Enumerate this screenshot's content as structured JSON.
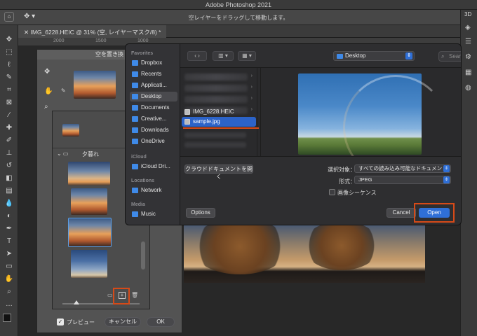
{
  "app": {
    "title": "Adobe Photoshop 2021",
    "hint": "空レイヤーをドラッグして移動します。",
    "doc_tab": "IMG_6228.HEIC @ 31% (空, レイヤーマスク/8) *",
    "ruler_ticks": [
      "2000",
      "1500",
      "1000"
    ],
    "right_panel_label": "3D"
  },
  "sky_dialog": {
    "title": "空を置き換",
    "folder_label": "夕暮れ",
    "preview_label": "プレビュー",
    "cancel_label": "キャンセル",
    "ok_label": "OK"
  },
  "file_dialog": {
    "sidebar": {
      "favorites_header": "Favorites",
      "favorites": [
        {
          "label": "Dropbox",
          "icon": "dropbox-icon"
        },
        {
          "label": "Recents",
          "icon": "clock-icon"
        },
        {
          "label": "Applicati...",
          "icon": "applications-icon"
        },
        {
          "label": "Desktop",
          "icon": "desktop-icon",
          "selected": true
        },
        {
          "label": "Documents",
          "icon": "document-icon"
        },
        {
          "label": "Creative...",
          "icon": "creative-cloud-icon"
        },
        {
          "label": "Downloads",
          "icon": "download-icon"
        },
        {
          "label": "OneDrive",
          "icon": "cloud-icon"
        }
      ],
      "icloud_header": "iCloud",
      "icloud_items": [
        {
          "label": "iCloud Dri...",
          "icon": "icloud-icon"
        }
      ],
      "locations_header": "Locations",
      "locations": [
        {
          "label": "Network",
          "icon": "globe-icon"
        }
      ],
      "media_header": "Media",
      "media": [
        {
          "label": "Music",
          "icon": "music-icon"
        }
      ]
    },
    "location": "Desktop",
    "search_placeholder": "Search",
    "files": [
      {
        "name": "IMG_6228.HEIC",
        "selected": false
      },
      {
        "name": "sample.jpg",
        "selected": true
      }
    ],
    "cloud_docs_button": "クラウドドキュメントを開く",
    "enable_label": "選択対象：",
    "enable_value": "すべての読み込み可能なドキュメント",
    "format_label": "形式：",
    "format_value": "JPEG",
    "image_sequence_label": "画像シーケンス",
    "options_button": "Options",
    "cancel_button": "Cancel",
    "open_button": "Open",
    "highlight_color": "#d64a18",
    "accent_color": "#2f6fd6"
  }
}
